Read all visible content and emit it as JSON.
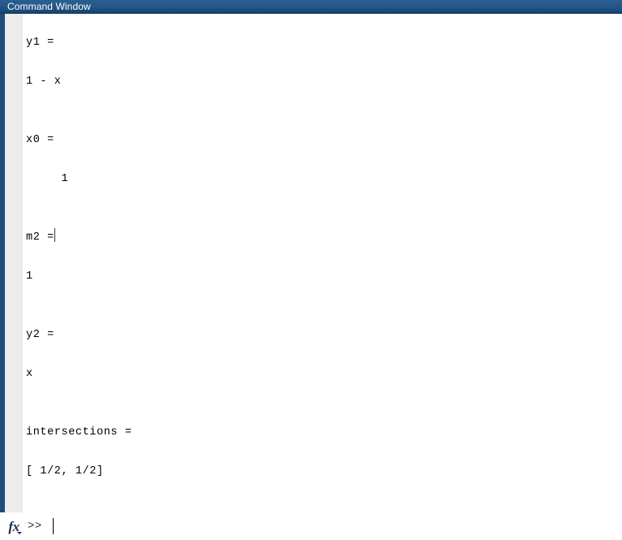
{
  "window": {
    "title": "Command Window",
    "titlebar_color": "#1f4c7a",
    "accent_bar_color": "#1f4c7a",
    "gutter_color": "#ececec",
    "background_color": "#ffffff",
    "text_color": "#000000"
  },
  "console": {
    "lines": [
      "",
      "y1 =",
      "",
      "1 - x",
      "",
      "",
      "x0 =",
      "",
      "     1",
      "",
      "",
      "m2 =",
      "",
      "1",
      "",
      "",
      "y2 =",
      "",
      "x",
      "",
      "",
      "intersections =",
      "",
      "[ 1/2, 1/2]"
    ],
    "caret_after_line_index": 11
  },
  "prompt": {
    "fx_label": "fx",
    "fx_icon": "function-browser-icon",
    "dropdown_icon": "chevron-down-icon",
    "prompt_symbol": ">>",
    "input_value": "",
    "input_placeholder": ""
  }
}
